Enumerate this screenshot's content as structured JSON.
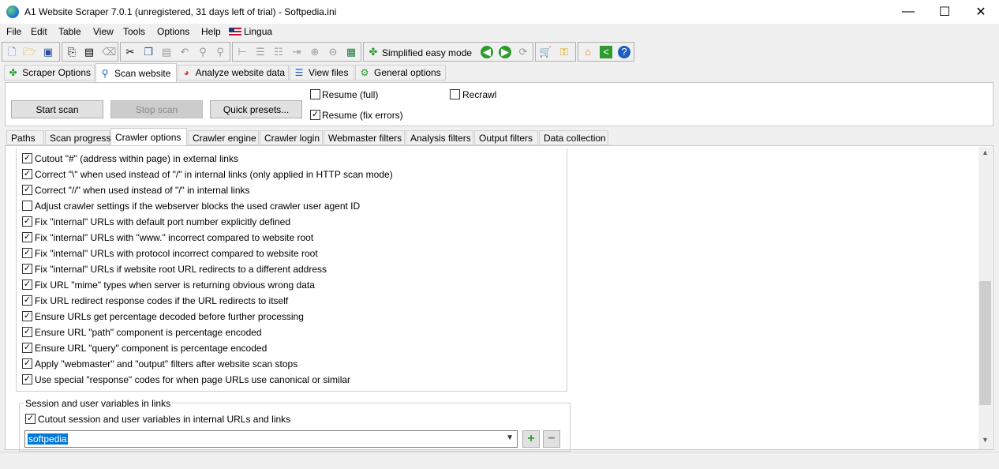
{
  "window": {
    "title": "A1 Website Scraper 7.0.1 (unregistered, 31 days left of trial) - Softpedia.ini",
    "minimize": "—",
    "maximize": "☐",
    "close": "✕"
  },
  "menu": [
    "File",
    "Edit",
    "Table",
    "View",
    "Tools",
    "Options",
    "Help",
    "Lingua"
  ],
  "toolbar": {
    "easy_mode_label": "Simplified easy mode",
    "icons": [
      "new-file-icon",
      "open-folder-icon",
      "save-icon",
      "copy-project-icon",
      "paste-project-icon",
      "erase-icon",
      "cut-icon",
      "copy-icon",
      "paste-icon",
      "undo-icon",
      "search-icon",
      "replace-icon",
      "tree-icon",
      "list-icon",
      "table-icon",
      "export-icon",
      "expand-icon",
      "collapse-icon",
      "columns-icon",
      "easy-mode-icon",
      "back-icon",
      "forward-icon",
      "refresh-icon",
      "cart-icon",
      "key-icon",
      "home-icon",
      "share-icon",
      "help-icon"
    ]
  },
  "main_tabs": [
    "Scraper Options",
    "Scan website",
    "Analyze website data",
    "View files",
    "General options"
  ],
  "scan_panel": {
    "start_scan": "Start scan",
    "stop_scan": "Stop scan",
    "quick_presets": "Quick presets...",
    "resume_full": "Resume (full)",
    "resume_fix": "Resume (fix errors)",
    "recrawl": "Recrawl",
    "resume_full_checked": false,
    "resume_fix_checked": true,
    "recrawl_checked": false
  },
  "sub_tabs": [
    "Paths",
    "Scan progress",
    "Crawler options",
    "Crawler engine",
    "Crawler login",
    "Webmaster filters",
    "Analysis filters",
    "Output filters",
    "Data collection"
  ],
  "options": [
    {
      "label": "Cutout \"#\" (address within page) in external links",
      "checked": true
    },
    {
      "label": "Correct \"\\\" when used instead of \"/\" in internal links (only applied in HTTP scan mode)",
      "checked": true
    },
    {
      "label": "Correct \"//\" when used instead of \"/\" in internal links",
      "checked": true
    },
    {
      "label": "Adjust crawler settings if the webserver blocks the used crawler user agent ID",
      "checked": false
    },
    {
      "label": "Fix \"internal\" URLs with default port number explicitly defined",
      "checked": true
    },
    {
      "label": "Fix \"internal\" URLs with \"www.\" incorrect compared to website root",
      "checked": true
    },
    {
      "label": "Fix \"internal\" URLs with protocol incorrect compared to website root",
      "checked": true
    },
    {
      "label": "Fix \"internal\" URLs if website root URL redirects to a different address",
      "checked": true
    },
    {
      "label": "Fix URL \"mime\" types when server is returning obvious wrong data",
      "checked": true
    },
    {
      "label": "Fix URL redirect response codes if the URL redirects to itself",
      "checked": true
    },
    {
      "label": "Ensure URLs get percentage decoded before further processing",
      "checked": true
    },
    {
      "label": "Ensure URL \"path\" component is percentage encoded",
      "checked": true
    },
    {
      "label": "Ensure URL \"query\" component is percentage encoded",
      "checked": true
    },
    {
      "label": "Apply \"webmaster\" and \"output\" filters after website scan stops",
      "checked": true
    },
    {
      "label": "Use special \"response\" codes for when page URLs use canonical or similar",
      "checked": true
    }
  ],
  "session": {
    "legend": "Session and user variables in links",
    "cutout_label": "Cutout session and user variables in internal URLs and links",
    "cutout_checked": true,
    "combo_value": "softpedia",
    "add": "+",
    "remove": "−"
  }
}
